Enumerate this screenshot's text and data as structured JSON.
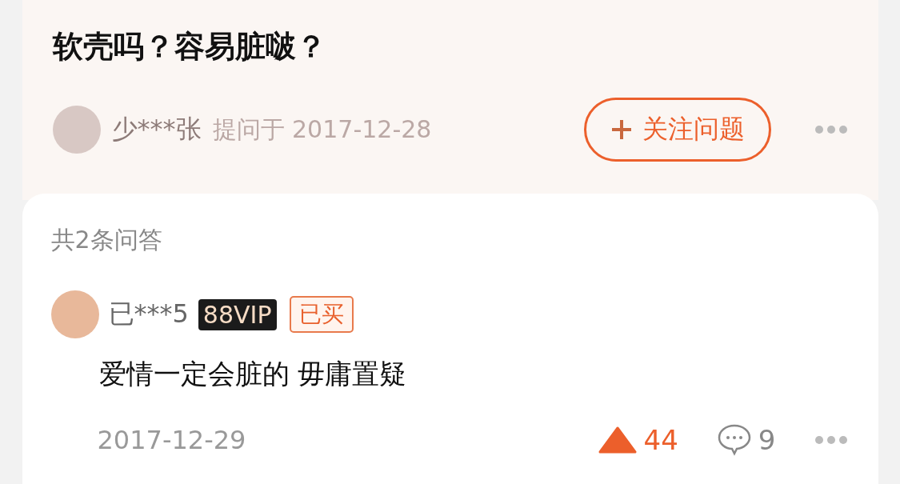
{
  "question": {
    "title": "软壳吗？容易脏啵？",
    "asker": "少***张",
    "asked_label": "提问于 2017-12-28",
    "follow_button": "关注问题"
  },
  "answers": {
    "count_label": "共2条问答",
    "items": [
      {
        "user": "已***5",
        "vip_badge": "88VIP",
        "bought_tag": "已买",
        "text": "爱情一定会脏的 毋庸置疑",
        "date": "2017-12-29",
        "likes": "44",
        "liked": true,
        "comments": "9"
      }
    ]
  }
}
